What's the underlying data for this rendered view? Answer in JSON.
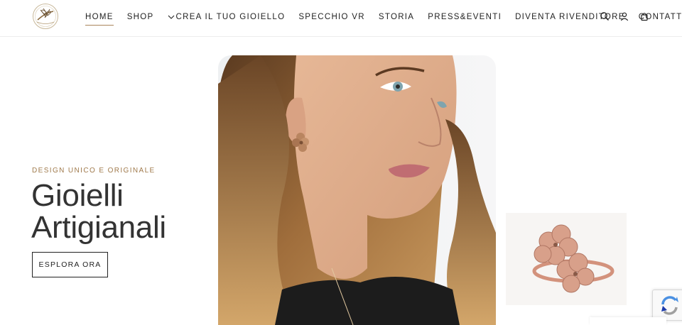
{
  "nav": {
    "items": [
      {
        "label": "HOME",
        "active": true
      },
      {
        "label": "SHOP"
      },
      {
        "label": "CREA IL TUO GIOIELLO",
        "has_dropdown": true
      },
      {
        "label": "SPECCHIO VR"
      },
      {
        "label": "STORIA"
      },
      {
        "label": "PRESS&EVENTI"
      },
      {
        "label": "DIVENTA RIVENDITORE"
      },
      {
        "label": "CONTATTI"
      }
    ],
    "icons": [
      "search-icon",
      "account-icon",
      "cart-icon"
    ]
  },
  "hero": {
    "eyebrow": "DESIGN UNICO E ORIGINALE",
    "title_line1": "Gioielli",
    "title_line2": "Artigianali",
    "cta_label": "ESPLORA ORA"
  },
  "colors": {
    "accent": "#a07a4c",
    "text": "#2b2b2b",
    "background": "#ffffff"
  }
}
